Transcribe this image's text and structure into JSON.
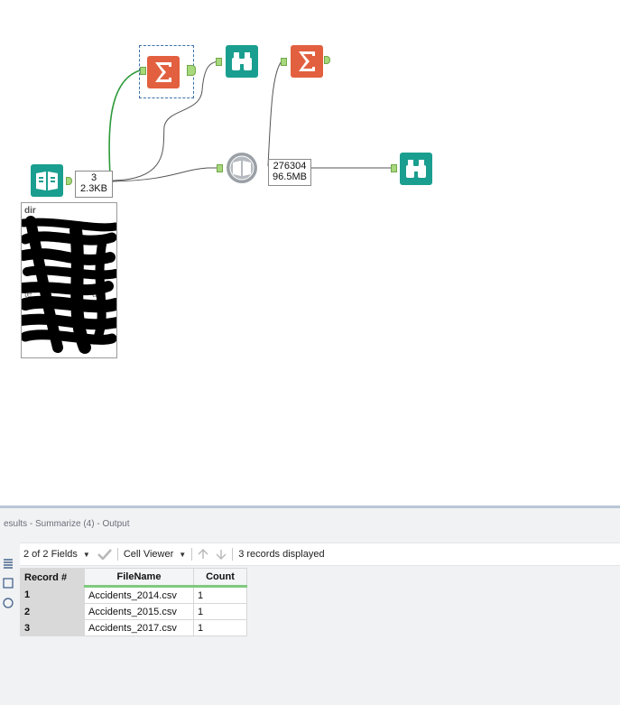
{
  "canvas": {
    "input_tool": {
      "icon": "input-data-icon",
      "color": "#1a9e8f"
    },
    "summarize_tool_1": {
      "icon": "summarize-icon",
      "color": "#e2603f",
      "selected": true
    },
    "summarize_tool_2": {
      "icon": "summarize-icon",
      "color": "#e2603f"
    },
    "browse_tool_1": {
      "icon": "binoculars-icon",
      "color": "#1a9e8f"
    },
    "browse_tool_2": {
      "icon": "binoculars-icon",
      "color": "#1a9e8f"
    },
    "dynamic_input_tool": {
      "icon": "dynamic-input-icon",
      "color": "#9aa0a6"
    },
    "input_count": {
      "records": "3",
      "size": "2.3KB"
    },
    "dynamic_count": {
      "records": "276304",
      "size": "96.5MB"
    },
    "browse_preview": {
      "label": "dir",
      "faint_1": "t",
      "faint_2": "te",
      "faint_3": "us"
    }
  },
  "results": {
    "title": "esults - Summarize (4) - Output",
    "toolbar": {
      "fields": "2 of 2 Fields",
      "viewer": "Cell Viewer",
      "status": "3 records displayed"
    },
    "grid": {
      "headers": {
        "record": "Record #",
        "filename": "FileName",
        "count": "Count"
      },
      "rows": [
        {
          "record": "1",
          "filename": "Accidents_2014.csv",
          "count": "1"
        },
        {
          "record": "2",
          "filename": "Accidents_2015.csv",
          "count": "1"
        },
        {
          "record": "3",
          "filename": "Accidents_2017.csv",
          "count": "1"
        }
      ]
    }
  }
}
